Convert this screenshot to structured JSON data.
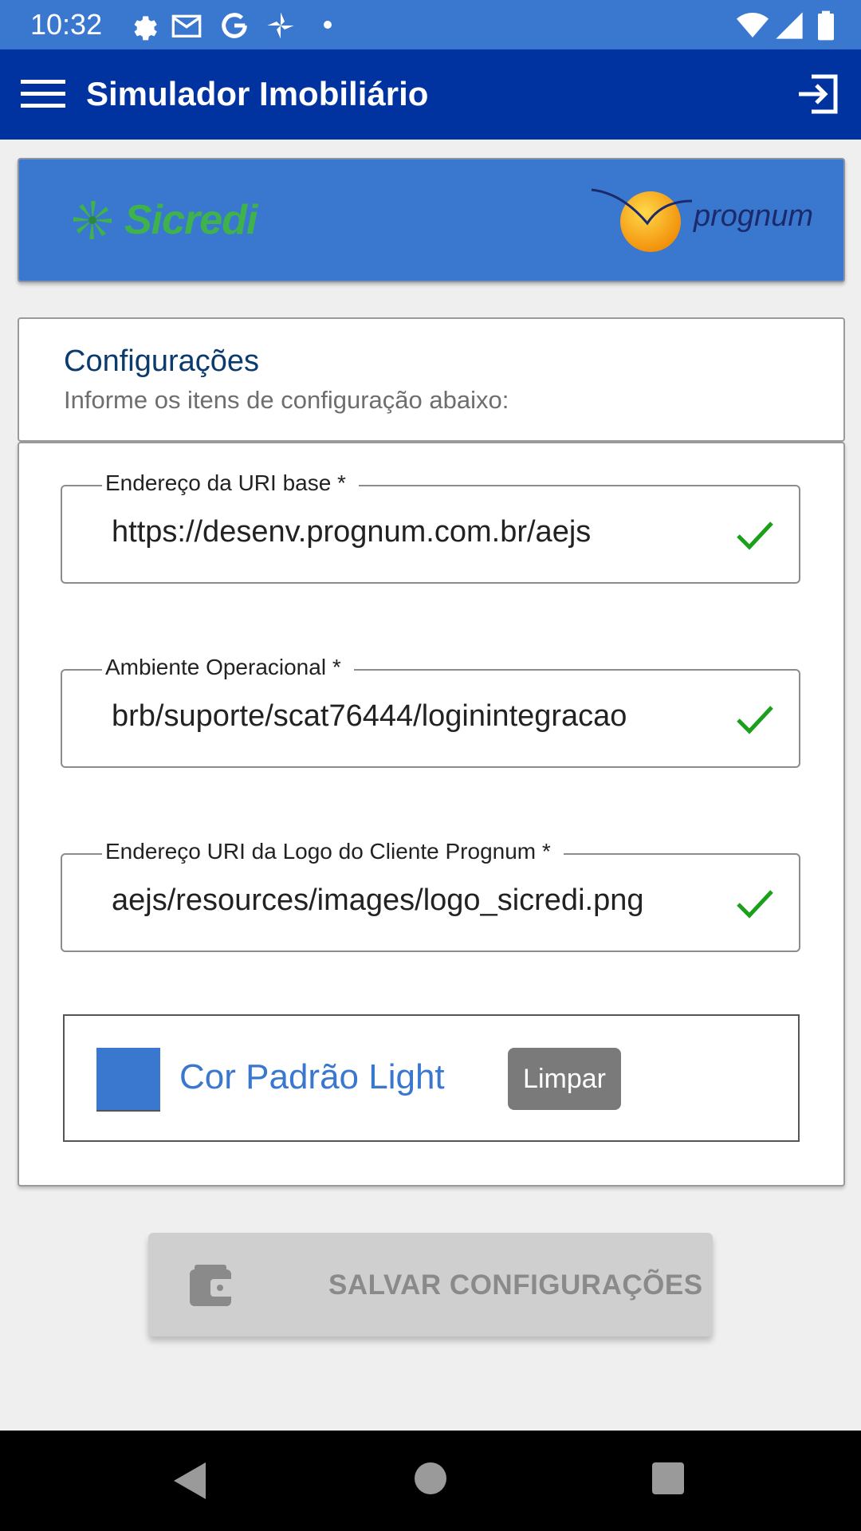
{
  "status_bar": {
    "time": "10:32"
  },
  "app_bar": {
    "title": "Simulador Imobiliário"
  },
  "banner": {
    "left_logo_text": "Sicredi",
    "right_logo_text": "prognum"
  },
  "config": {
    "title": "Configurações",
    "subtitle": "Informe os itens de configuração abaixo:"
  },
  "fields": [
    {
      "label": "Endereço da URI base *",
      "value": "https://desenv.prognum.com.br/aejs"
    },
    {
      "label": "Ambiente Operacional *",
      "value": "brb/suporte/scat76444/loginintegracao"
    },
    {
      "label": "Endereço URI da Logo do Cliente Prognum *",
      "value": "aejs/resources/images/logo_sicredi.png"
    }
  ],
  "color": {
    "label": "Cor Padrão Light",
    "clear_label": "Limpar",
    "swatch": "#3a78cf"
  },
  "save_button": {
    "label": "SALVAR CONFIGURAÇÕES"
  },
  "colors": {
    "app_bar": "#0033a0",
    "status_bar": "#3a78cf",
    "check": "#1aa01a",
    "sicredi_green": "#3fb24b"
  }
}
